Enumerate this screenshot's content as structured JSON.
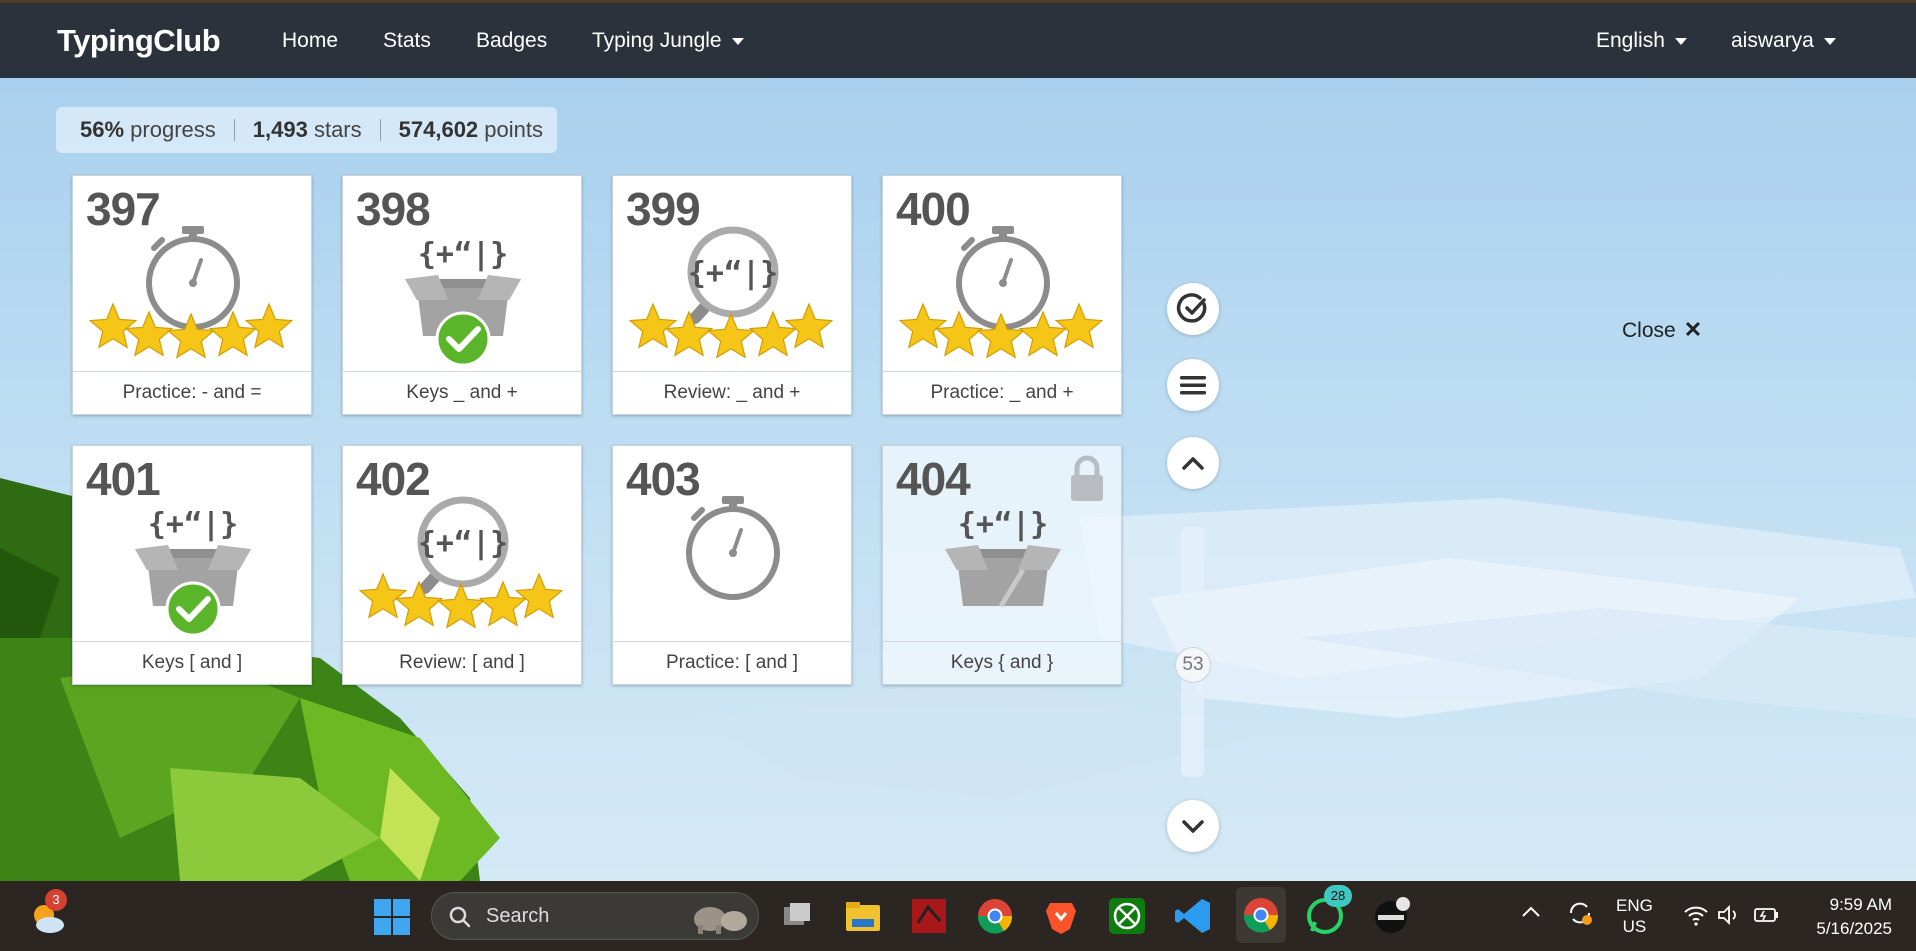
{
  "navbar": {
    "brand": "TypingClub",
    "links": [
      "Home",
      "Stats",
      "Badges"
    ],
    "dropdown": "Typing Jungle",
    "language": "English",
    "user": "aiswarya"
  },
  "progress": {
    "percent": "56%",
    "percent_label": "progress",
    "stars": "1,493",
    "stars_label": "stars",
    "points": "574,602",
    "points_label": "points"
  },
  "lessons": [
    {
      "number": "397",
      "label": "Practice: - and =",
      "type": "stopwatch",
      "stars": 5,
      "locked": false
    },
    {
      "number": "398",
      "label": "Keys _ and +",
      "type": "box-completed",
      "stars": 0,
      "locked": false
    },
    {
      "number": "399",
      "label": "Review: _ and +",
      "type": "magnifier",
      "stars": 5,
      "locked": false
    },
    {
      "number": "400",
      "label": "Practice: _ and +",
      "type": "stopwatch",
      "stars": 5,
      "locked": false
    },
    {
      "number": "401",
      "label": "Keys [ and ]",
      "type": "box-completed",
      "stars": 0,
      "locked": false
    },
    {
      "number": "402",
      "label": "Review: [ and ]",
      "type": "magnifier",
      "stars": 5,
      "locked": false
    },
    {
      "number": "403",
      "label": "Practice: [ and ]",
      "type": "stopwatch",
      "stars": 0,
      "locked": false
    },
    {
      "number": "404",
      "label": "Keys { and }",
      "type": "box",
      "stars": 0,
      "locked": true
    }
  ],
  "key_glyph": "{+“|}",
  "side_controls": {
    "icons": [
      "check-circle-icon",
      "menu-icon",
      "chevron-up-icon",
      "chevron-down-icon"
    ],
    "page_indicator": "53",
    "close_label": "Close",
    "close_glyph": "✕"
  },
  "taskbar": {
    "weather_badge": "3",
    "search_placeholder": "Search",
    "whatsapp_badge": "28",
    "lang_line1": "ENG",
    "lang_line2": "US",
    "time": "9:59 AM",
    "date": "5/16/2025"
  },
  "colors": {
    "nav_bg": "#2b323b",
    "star": "#f5c518",
    "check": "#5bb52b",
    "taskbar": "#2b2621"
  }
}
